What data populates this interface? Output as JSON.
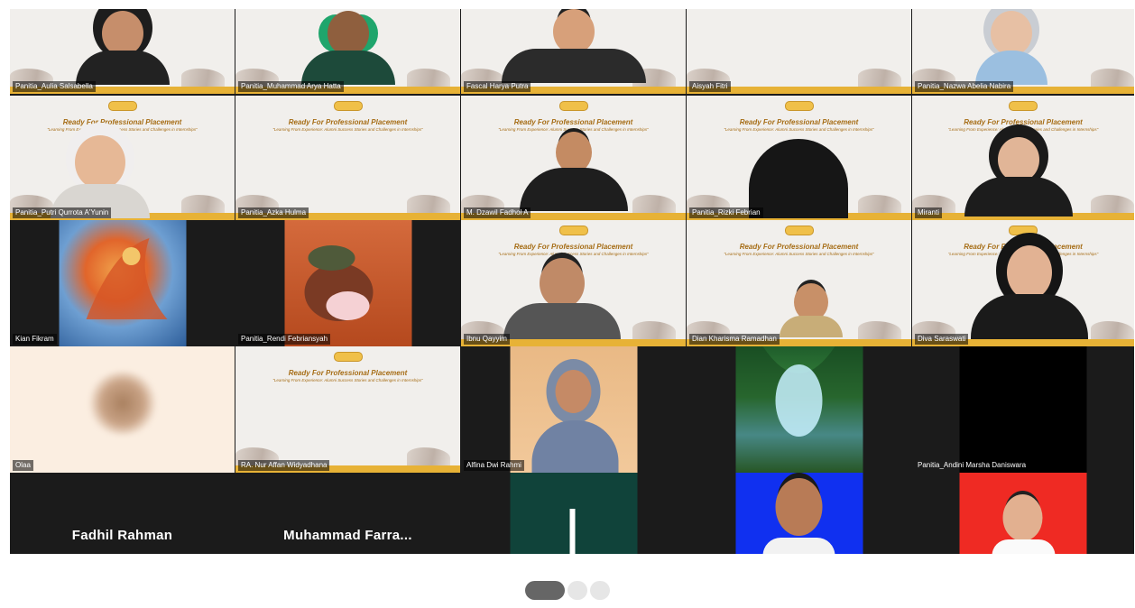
{
  "banner": {
    "title": "Ready For Professional Placement",
    "subtitle": "\"Learning From Experience: Alumni Success Stories and Challenges in Internships\""
  },
  "participants": {
    "aulia": "Panitia_Aulia Salsabella",
    "arya": "Panitia_Muhammad Arya Hatta",
    "fascal": "Fascal Harya Putra",
    "aisyah": "Aisyah Fitri",
    "nazwa": "Panitia_Nazwa Abelia Nabira",
    "putri": "Panitia_Putri Qurrota A'Yunin",
    "azka": "Panitia_Azka Hulma",
    "dzawil": "M. Dzawil Fadhol A",
    "rizki": "Panitia_Rizki Febrian",
    "miranti": "Miranti",
    "kian": "Kian Fikram",
    "rendi": "Panitia_Rendi Febriansyah",
    "ibnu": "Ibnu Qayyim",
    "dian": "Dian Kharisma Ramadhan",
    "diva": "Diva Saraswati",
    "olaa": "Olaa",
    "affan": "RA. Nur Affan Widyadhana",
    "alfina": "Alfina Dwi Rahmi",
    "andini": "Panitia_Andini Marsha Daniswara",
    "fadhil": "Fadhil Rahman",
    "farra": "Muhammad  Farra..."
  },
  "pagination": {
    "pages": 3,
    "current": 1
  },
  "colors": {
    "banner_gold": "#e7b236",
    "tile_dark": "#1b1b1b",
    "dot_active": "#666666",
    "dot_inactive": "#e6e6e6"
  }
}
